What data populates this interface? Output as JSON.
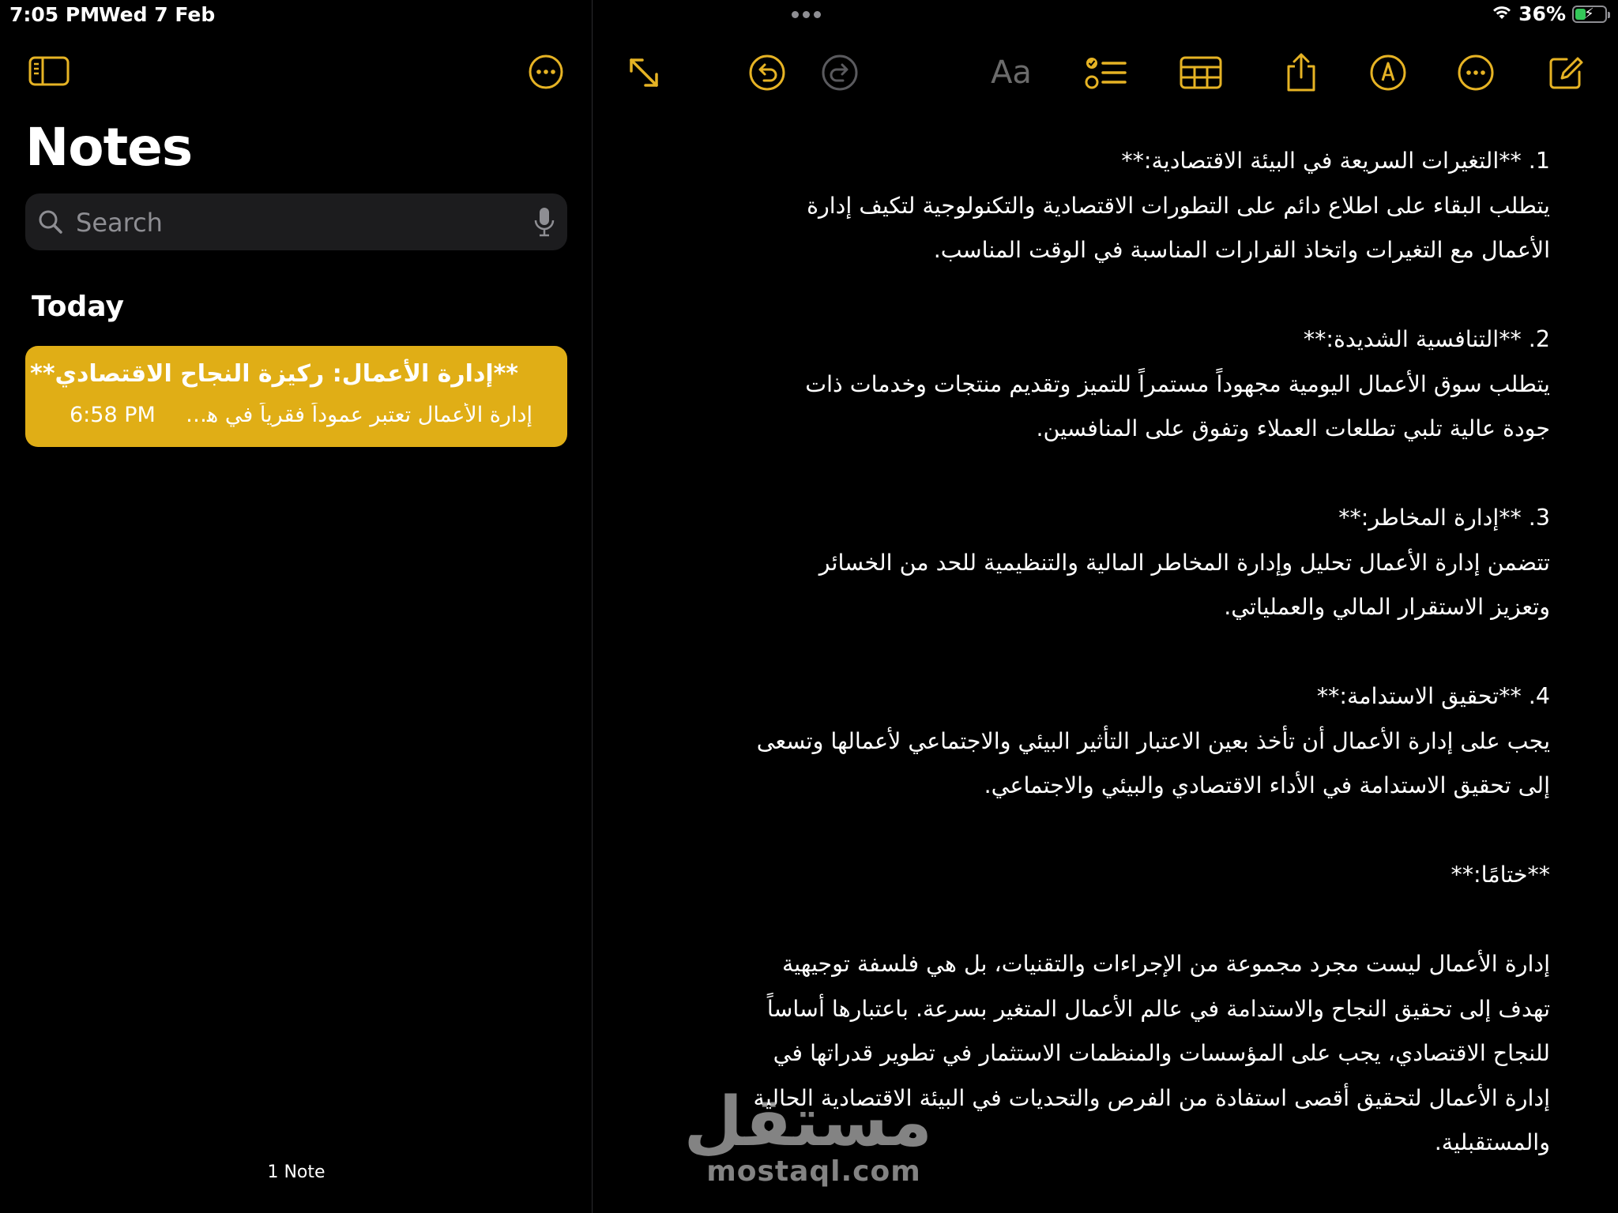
{
  "status_bar": {
    "time": "7:05 PM",
    "date": "Wed 7 Feb",
    "battery_percent": "36%",
    "battery_level": 0.36,
    "battery_color": "#34c759",
    "wifi_icon": "wifi-icon"
  },
  "sidebar": {
    "title": "Notes",
    "search_placeholder": "Search",
    "section_label": "Today",
    "note": {
      "title": "**إدارة الأعمال: ركيزة النجاح الاقتصادي**",
      "time": "6:58 PM",
      "preview": "إدارة الأعمال تعتبر عموداً فقرياً في هيكل"
    },
    "note_count": "1 Note",
    "accent_color": "#e0ae16"
  },
  "toolbar": {
    "format_label": "Aa",
    "icons": [
      "expand-icon",
      "undo-icon",
      "redo-icon",
      "format-icon",
      "checklist-icon",
      "table-icon",
      "share-icon",
      "markup-icon",
      "more-icon",
      "compose-icon"
    ],
    "accent_color": "#e6b324"
  },
  "note_body": {
    "lines": [
      "1. **التغيرات السريعة في البيئة الاقتصادية:**",
      "   يتطلب البقاء على اطلاع دائم على التطورات الاقتصادية والتكنولوجية لتكيف إدارة",
      "الأعمال مع التغيرات واتخاذ القرارات المناسبة في الوقت المناسب.",
      "",
      "2. **التنافسية الشديدة:**",
      "   يتطلب سوق الأعمال اليومية مجهوداً مستمراً للتميز وتقديم منتجات وخدمات ذات",
      "جودة عالية تلبي تطلعات العملاء وتفوق على المنافسين.",
      "",
      "3. **إدارة المخاطر:**",
      "   تتضمن إدارة الأعمال تحليل وإدارة المخاطر المالية والتنظيمية للحد من الخسائر",
      "وتعزيز الاستقرار المالي والعملياتي.",
      "",
      "4. **تحقيق الاستدامة:**",
      "   يجب على إدارة الأعمال أن تأخذ بعين الاعتبار التأثير البيئي والاجتماعي لأعمالها وتسعى",
      "إلى تحقيق الاستدامة في الأداء الاقتصادي والبيئي والاجتماعي.",
      "",
      "**ختامًا:**",
      "",
      "إدارة الأعمال ليست مجرد مجموعة من الإجراءات والتقنيات، بل هي فلسفة توجيهية",
      "تهدف إلى تحقيق النجاح والاستدامة في عالم الأعمال المتغير بسرعة. باعتبارها أساساً",
      "للنجاح الاقتصادي، يجب على المؤسسات والمنظمات الاستثمار في تطوير قدراتها في",
      "إدارة الأعمال لتحقيق أقصى استفادة من الفرص والتحديات في البيئة الاقتصادية الحالية",
      "والمستقبلية."
    ]
  },
  "watermark": {
    "arabic": "مستقل",
    "latin": "mostaql.com"
  }
}
